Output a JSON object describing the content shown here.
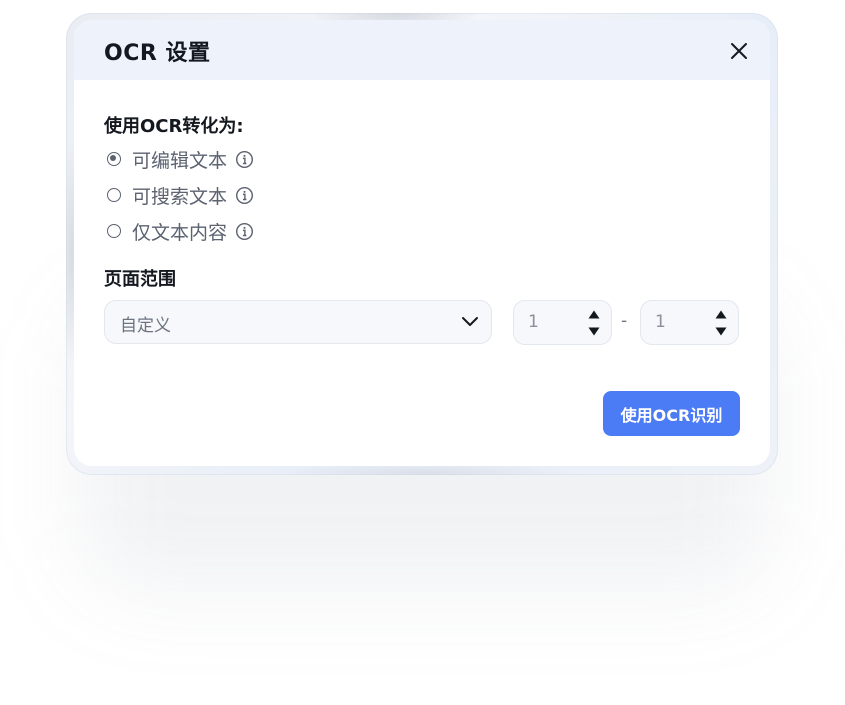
{
  "dialog": {
    "title": "OCR 设置",
    "close_icon": "close-icon"
  },
  "ocr_mode": {
    "label": "使用OCR转化为:",
    "options": [
      {
        "label": "可编辑文本",
        "checked": true,
        "icon": "info-icon"
      },
      {
        "label": "可搜索文本",
        "checked": false,
        "icon": "info-icon"
      },
      {
        "label": "仅文本内容",
        "checked": false,
        "icon": "info-icon"
      }
    ]
  },
  "page_range": {
    "label": "页面范围",
    "select_value": "自定义",
    "from": "1",
    "separator": "-",
    "to": "1"
  },
  "actions": {
    "submit_label": "使用OCR识别"
  },
  "colors": {
    "accent": "#4b7bf5",
    "header_bg": "#eef2fb",
    "text_primary": "#14181f",
    "text_secondary": "#5b6270"
  }
}
